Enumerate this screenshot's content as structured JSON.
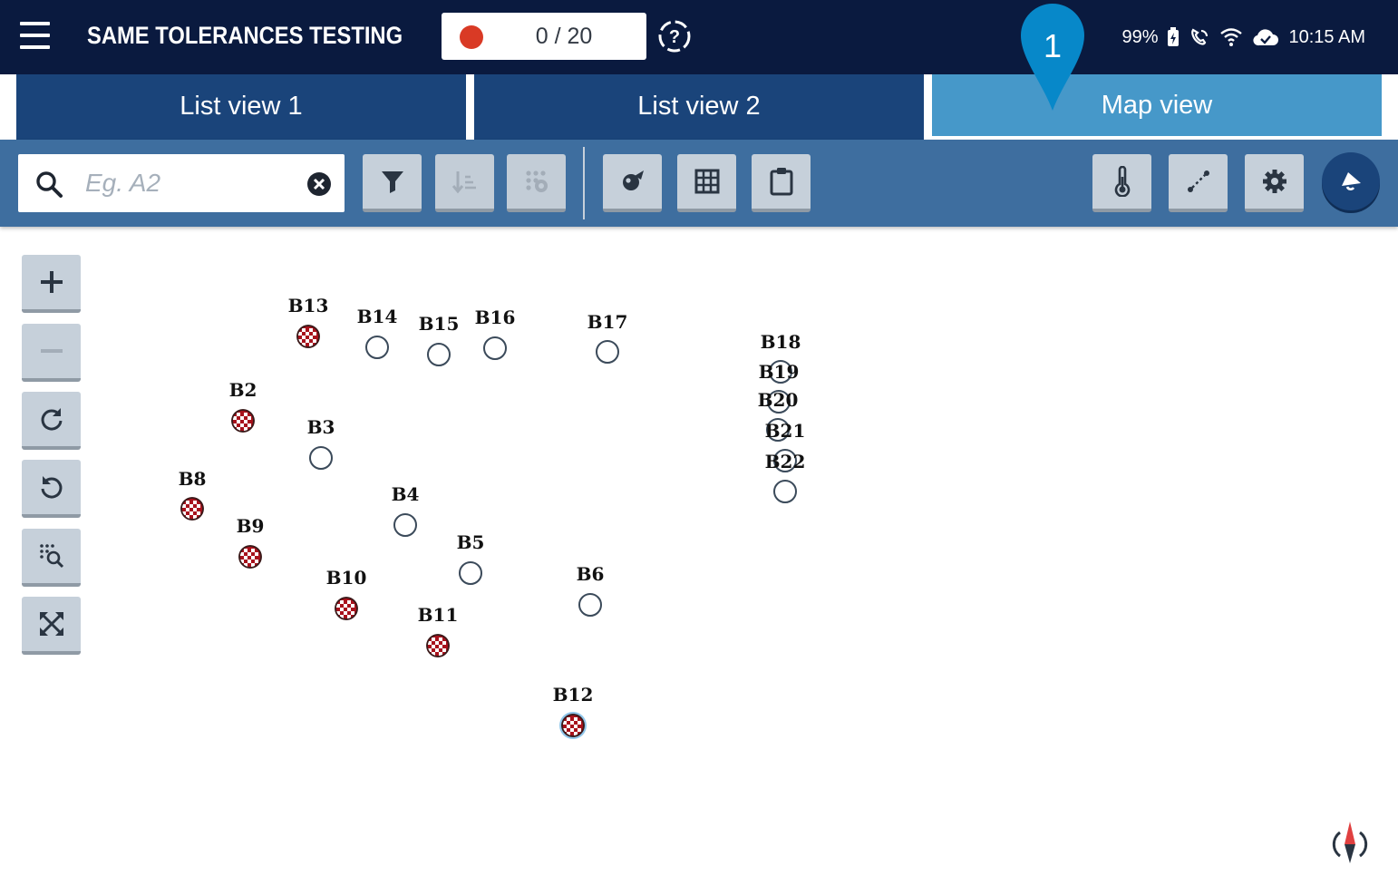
{
  "header": {
    "title": "SAME TOLERANCES TESTING",
    "counter": "0 / 20",
    "status": {
      "battery": "99%",
      "time": "10:15 AM"
    }
  },
  "tabs": [
    {
      "label": "List view 1",
      "active": false
    },
    {
      "label": "List view 2",
      "active": false
    },
    {
      "label": "Map view",
      "active": true
    }
  ],
  "search": {
    "placeholder": "Eg. A2",
    "value": ""
  },
  "tour_pin": {
    "label": "1"
  },
  "map": {
    "markers": [
      {
        "id": "B13",
        "state": "done"
      },
      {
        "id": "B14",
        "state": "pending"
      },
      {
        "id": "B15",
        "state": "pending"
      },
      {
        "id": "B16",
        "state": "pending"
      },
      {
        "id": "B17",
        "state": "pending"
      },
      {
        "id": "B18",
        "state": "pending"
      },
      {
        "id": "B19",
        "state": "pending"
      },
      {
        "id": "B20",
        "state": "pending"
      },
      {
        "id": "B21",
        "state": "pending"
      },
      {
        "id": "B22",
        "state": "pending"
      },
      {
        "id": "B2",
        "state": "done"
      },
      {
        "id": "B3",
        "state": "pending"
      },
      {
        "id": "B8",
        "state": "done"
      },
      {
        "id": "B9",
        "state": "done"
      },
      {
        "id": "B4",
        "state": "pending"
      },
      {
        "id": "B5",
        "state": "pending"
      },
      {
        "id": "B6",
        "state": "pending"
      },
      {
        "id": "B10",
        "state": "done"
      },
      {
        "id": "B11",
        "state": "done"
      },
      {
        "id": "B12",
        "state": "selected"
      }
    ]
  },
  "colors": {
    "topbar": "#0a1a3f",
    "tab": "#1a447a",
    "tab_active": "#4698c9",
    "toolbar": "#3e6e9f",
    "record": "#d93a25",
    "marker_done": "#a8121c"
  },
  "icons": {
    "toolbar": [
      "filter-icon",
      "sort-icon",
      "cluster-icon",
      "locate-icon",
      "grid-icon",
      "clipboard-icon",
      "thermometer-icon",
      "measure-icon",
      "gear-icon",
      "bell-icon"
    ],
    "map_controls": [
      "zoom-in-icon",
      "zoom-out-icon",
      "rotate-cw-icon",
      "rotate-ccw-icon",
      "zoom-area-icon",
      "fit-icon"
    ]
  }
}
